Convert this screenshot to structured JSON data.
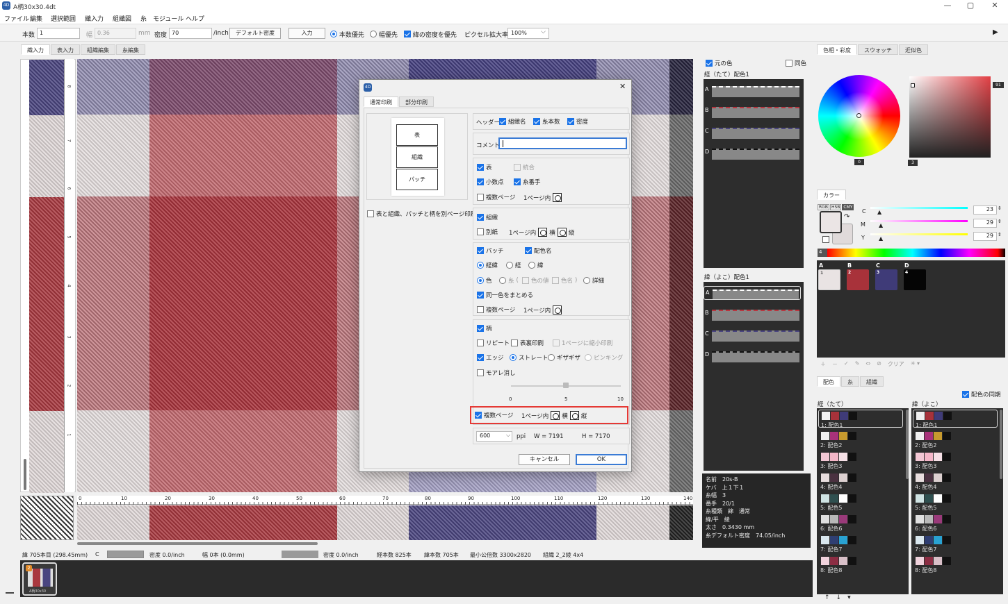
{
  "window": {
    "title": "A柄30x30.4dt",
    "min": "—",
    "max": "▢",
    "close": "✕",
    "app_icon": "4D"
  },
  "menu": [
    "ファイル",
    "編集",
    "選択範囲",
    "織入力",
    "組織図",
    "糸",
    "モジュール",
    "ヘルプ"
  ],
  "toolbar": {
    "count_label": "本数",
    "count_value": "1",
    "width_label": "幅",
    "width_value": "0.36",
    "width_unit": "mm",
    "density_label": "密度",
    "density_value": "70",
    "density_unit": "/inch",
    "default_density_btn": "デフォルト密度",
    "input_btn": "入力",
    "radio1": "本数優先",
    "radio2": "幅優先",
    "check_weft": "緯の密度を優先",
    "pixel_zoom_label": "ピクセル拡大率",
    "pixel_zoom_value": "100%",
    "play_icon": "▶"
  },
  "left_tabs": [
    "織入力",
    "表入力",
    "組織編集",
    "糸編集"
  ],
  "ruler": {
    "h_ticks": [
      "0",
      "10",
      "20",
      "30",
      "40",
      "50",
      "60",
      "70",
      "80",
      "90",
      "100",
      "110",
      "120",
      "130",
      "140"
    ],
    "v_ticks": [
      "8",
      "7",
      "6",
      "5",
      "4",
      "3",
      "2",
      "1"
    ]
  },
  "status": {
    "weft_pos": "緯 705本目 (298.45mm)",
    "c_label": "C",
    "density1": "密度 0.0/inch",
    "width_count": "幅 0本 (0.0mm)",
    "density2": "密度 0.0/inch",
    "warp_count": "経本数 825本",
    "weft_count": "緯本数 705本",
    "lcm": "最小公倍数 3300x2820",
    "weave": "組織 2_2綾 4x4"
  },
  "thumbnail": {
    "label": "A柄30x30",
    "badge": "2"
  },
  "dialog": {
    "icon": "4D",
    "close": "✕",
    "tabs": [
      "通常印刷",
      "部分印刷"
    ],
    "preview": [
      "表",
      "組織",
      "パッチ"
    ],
    "separate_pages": "表と組織、パッチと柄を別ページ印刷",
    "header": {
      "label": "ヘッダー",
      "c1": "組織名",
      "c2": "糸本数",
      "c3": "密度"
    },
    "comment_label": "コメント",
    "comment_value": "",
    "table": {
      "c1": "表",
      "c2": "統合",
      "c3": "小数点",
      "c4": "糸番手",
      "c5": "複数ページ",
      "perpage": "1ページ内"
    },
    "weave": {
      "c1": "組織",
      "c2": "別紙",
      "perpage": "1ページ内",
      "h": "横",
      "v": "縦"
    },
    "patch": {
      "c1": "パッチ",
      "c2": "配色名",
      "r1": "経緯",
      "r2": "経",
      "r3": "緯",
      "r4": "色",
      "r5": "糸",
      "paren_open": "(",
      "c3": "色の値",
      "c4": "色名",
      "paren_close": ")",
      "r6": "詳細",
      "c5": "同一色をまとめる",
      "c6": "複数ページ",
      "perpage": "1ページ内"
    },
    "pattern": {
      "c1": "柄",
      "c2": "リピート",
      "c3": "表裏印刷",
      "c4": "1ページに縮小印刷",
      "c5": "エッジ",
      "r1": "ストレート",
      "r2": "ギザギザ",
      "r3": "ピンキング",
      "c6": "モアレ消し",
      "slider_min": "0",
      "slider_mid": "5",
      "slider_max": "10",
      "slider_value": 5,
      "c7": "複数ページ",
      "perpage": "1ページ内",
      "h": "横",
      "v": "縦"
    },
    "ppi_value": "600",
    "ppi_label": "ppi",
    "w": "W = 7191",
    "h": "H = 7170",
    "cancel": "キャンセル",
    "ok": "OK"
  },
  "yarn_panel": {
    "orig_color": "元の色",
    "same_color": "同色",
    "warp_title": "経（たて）配色1",
    "weft_title": "緯（よこ）配色1",
    "rows": [
      "A",
      "B",
      "C",
      "D"
    ],
    "info": [
      "名前　20s-B",
      "ケバ　上１下１",
      "糸幅　3",
      "番手　20/1",
      "糸種類　綿　通常",
      "緯/平　綾",
      "太さ　0.3430 mm",
      "糸デフォルト密度　74.05/inch"
    ]
  },
  "color_panel": {
    "tabs": [
      "色相・彩度",
      "スウォッチ",
      "近似色"
    ],
    "hue_value": "0",
    "sv_value": "91",
    "sv_bottom": "3",
    "color_title": "カラー",
    "modes": [
      "RGB",
      "HSB",
      "CMY"
    ],
    "sliders": [
      {
        "label": "C",
        "value": "23"
      },
      {
        "label": "M",
        "value": "29"
      },
      {
        "label": "Y",
        "value": "29"
      }
    ],
    "ramp_label": "4",
    "swatches": [
      {
        "label": "A",
        "num": "1",
        "color": "#e9e3e3"
      },
      {
        "label": "B",
        "num": "2",
        "color": "#a8323a"
      },
      {
        "label": "C",
        "num": "3",
        "color": "#3f3b78"
      },
      {
        "label": "D",
        "num": "4",
        "color": "#050505"
      }
    ],
    "clear_label": "クリア",
    "tools": [
      "＋",
      "－",
      "✓",
      "✎",
      "⇔",
      "⊘"
    ],
    "sub_tabs": [
      "配色",
      "糸",
      "組織"
    ],
    "sync": "配色の同期",
    "warp_col": "経（たて）",
    "weft_col": "緯（よこ）",
    "palettes": [
      "1: 配色1",
      "2: 配色2",
      "3: 配色3",
      "4: 配色4",
      "5: 配色5",
      "6: 配色6",
      "7: 配色7",
      "8: 配色8"
    ],
    "palette_colors": [
      [
        "#f0f0f0",
        "#a8323a",
        "#3f3b78",
        "#111111"
      ],
      [
        "#f0f0f0",
        "#a8327a",
        "#c79a2e",
        "#111111"
      ],
      [
        "#f3c7d4",
        "#f5b6c8",
        "#f6e0e6",
        "#111111"
      ],
      [
        "#e8dede",
        "#4a3140",
        "#dcd0d0",
        "#111111"
      ],
      [
        "#cfe3e3",
        "#2f5050",
        "#ffffff",
        "#111111"
      ],
      [
        "#e0e0e0",
        "#b9b9b9",
        "#9a3a7a",
        "#111111"
      ],
      [
        "#d9e7ee",
        "#2f3f73",
        "#29a2d2",
        "#111111"
      ],
      [
        "#f0d2dc",
        "#8c2d43",
        "#d9c0c8",
        "#111111"
      ]
    ],
    "bottom_tools": [
      "↑",
      "↓",
      "▾"
    ]
  }
}
